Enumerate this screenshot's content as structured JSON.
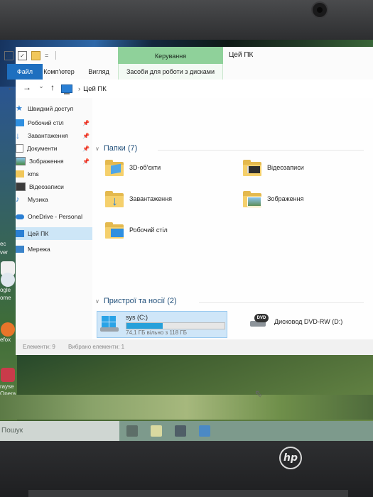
{
  "quick_access_toolbar": {
    "customize_label": "="
  },
  "window": {
    "title": "Цей ПК",
    "contextual_tab_header": "Керування"
  },
  "ribbon": {
    "tabs": [
      "Файл",
      "Комп'ютер",
      "Вигляд",
      "Засоби для роботи з дисками"
    ]
  },
  "address": {
    "path": "Цей ПК",
    "back": "←",
    "forward": "→",
    "recent": "⌄",
    "up": "↑",
    "sep": "›"
  },
  "nav": {
    "quick_access": "Швидкий доступ",
    "items": [
      {
        "label": "Робочий стіл",
        "pinned": true
      },
      {
        "label": "Завантаження",
        "pinned": true
      },
      {
        "label": "Документи",
        "pinned": true
      },
      {
        "label": "Зображення",
        "pinned": true
      },
      {
        "label": "kms",
        "pinned": false
      },
      {
        "label": "Відеозаписи",
        "pinned": false
      },
      {
        "label": "Музика",
        "pinned": false
      }
    ],
    "onedrive": "OneDrive - Personal",
    "this_pc": "Цей ПК",
    "network": "Мережа"
  },
  "folders": {
    "header": "Папки (7)",
    "items": [
      {
        "label": "3D-об'єкти",
        "icon": "3d-objects-icon"
      },
      {
        "label": "Відеозаписи",
        "icon": "videos-folder-icon"
      },
      {
        "label": "Завантаження",
        "icon": "downloads-folder-icon"
      },
      {
        "label": "Зображення",
        "icon": "pictures-folder-icon"
      },
      {
        "label": "Робочий стіл",
        "icon": "desktop-folder-icon"
      }
    ]
  },
  "devices": {
    "header": "Пристрої та носії (2)",
    "drive_c": {
      "name": "sys (C:)",
      "free_text": "74,1 ГБ вільно з 118 ГБ",
      "used_fraction": 0.37
    },
    "dvd": {
      "name": "Дисковод DVD-RW (D:)",
      "badge": "DVD"
    }
  },
  "statusbar": {
    "items_count": "Елементи: 9",
    "selected": "Вибрано елементи: 1"
  },
  "taskbar": {
    "search_placeholder": "Пошук"
  },
  "desktop": {
    "labels": [
      "ec",
      "ver",
      "ogle",
      "ome",
      "efox",
      "rayse",
      "Opera"
    ]
  },
  "brand": {
    "logo_text": "hp"
  },
  "colors": {
    "accent": "#1e6fbf",
    "contextual_tab": "#8fd19a",
    "selection": "#cde6f7",
    "drive_fill": "#26a0da"
  }
}
